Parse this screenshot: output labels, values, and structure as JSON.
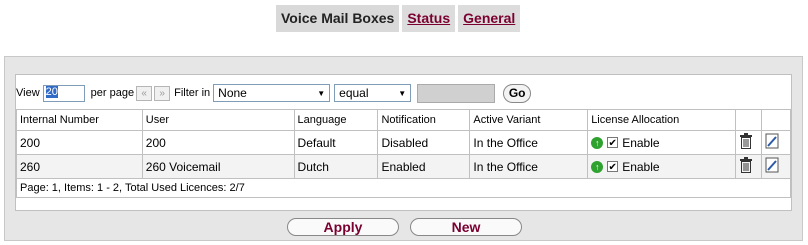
{
  "tabs": [
    {
      "label": "Voice Mail Boxes",
      "active": true
    },
    {
      "label": "Status",
      "active": false
    },
    {
      "label": "General",
      "active": false
    }
  ],
  "filter": {
    "view_label": "View",
    "view_value": "20",
    "per_page_label": "per page",
    "prev_glyph": "«",
    "next_glyph": "»",
    "filter_in_label": "Filter in",
    "filter_field": "None",
    "operator": "equal",
    "filter_value": "",
    "go_label": "Go"
  },
  "table": {
    "headers": [
      "Internal Number",
      "User",
      "Language",
      "Notification",
      "Active Variant",
      "License Allocation",
      "",
      ""
    ],
    "rows": [
      {
        "internal_number": "200",
        "user": "200",
        "language": "Default",
        "notification": "Disabled",
        "active_variant": "In the Office",
        "license": "Enable",
        "enabled": true
      },
      {
        "internal_number": "260",
        "user": "260 Voicemail",
        "language": "Dutch",
        "notification": "Enabled",
        "active_variant": "In the Office",
        "license": "Enable",
        "enabled": true
      }
    ],
    "footer": "Page:  1, Items:  1 - 2,  Total Used Licences: 2/7"
  },
  "buttons": {
    "apply": "Apply",
    "new": "New"
  },
  "colors": {
    "link": "#7a0030",
    "tab_bg": "#d9d9d9",
    "panel_bg": "#e6e6e6",
    "status_green": "#2fa12f"
  }
}
